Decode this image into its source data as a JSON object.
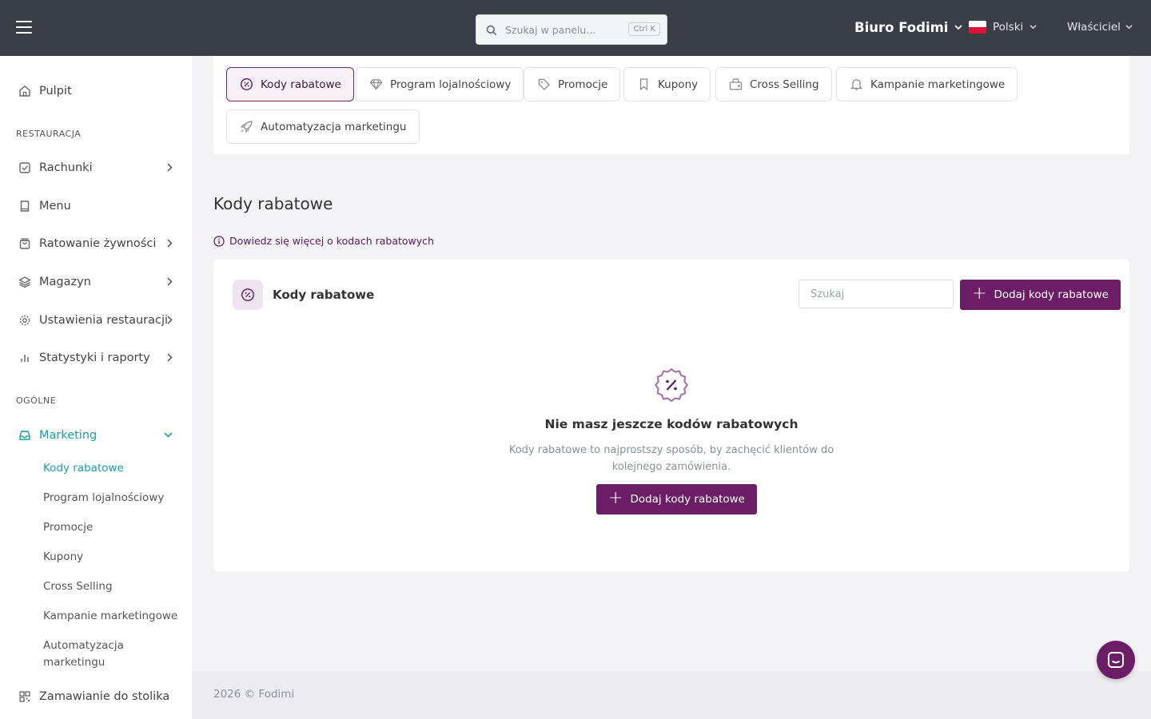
{
  "topbar": {
    "search_placeholder": "Szukaj w panelu...",
    "search_shortcut": "Ctrl K",
    "organization": "Biuro Fodimi",
    "language": "Polski",
    "role": "Właściciel"
  },
  "sidebar": {
    "dashboard": "Pulpit",
    "section_restaurant": "RESTAURACJA",
    "items": [
      {
        "label": "Rachunki",
        "icon": "receipt-check-icon"
      },
      {
        "label": "Menu",
        "icon": "book-icon"
      },
      {
        "label": "Ratowanie żywności",
        "icon": "shopping-bag-icon"
      },
      {
        "label": "Magazyn",
        "icon": "layers-icon"
      },
      {
        "label": "Ustawienia restauracji",
        "icon": "gear-icon"
      },
      {
        "label": "Statystyki i raporty",
        "icon": "bar-chart-icon"
      }
    ],
    "section_general": "OGÓLNE",
    "marketing": "Marketing",
    "marketing_sub": [
      "Kody rabatowe",
      "Program lojalnościowy",
      "Promocje",
      "Kupony",
      "Cross Selling",
      "Kampanie marketingowe",
      "Automatyzacja marketingu"
    ],
    "table_ordering": "Zamawianie do stolika"
  },
  "tabs": [
    {
      "label": "Kody rabatowe",
      "icon": "discount-badge-icon"
    },
    {
      "label": "Program lojalnościowy",
      "icon": "diamond-icon"
    },
    {
      "label": "Promocje",
      "icon": "tag-icon"
    },
    {
      "label": "Kupony",
      "icon": "bookmark-icon"
    },
    {
      "label": "Cross Selling",
      "icon": "basket-icon"
    },
    {
      "label": "Kampanie marketingowe",
      "icon": "bell-icon"
    },
    {
      "label": "Automatyzacja marketingu",
      "icon": "rocket-icon"
    }
  ],
  "page": {
    "title": "Kody rabatowe",
    "learn_more": "Dowiedz się więcej o kodach rabatowych"
  },
  "card": {
    "title": "Kody rabatowe",
    "search_placeholder": "Szukaj",
    "add_button": "Dodaj kody rabatowe",
    "empty_title": "Nie masz jeszcze kodów rabatowych",
    "empty_desc": "Kody rabatowe to najprostszy sposób, by zachęcić klientów do kolejnego zamówienia.",
    "empty_button": "Dodaj kody rabatowe"
  },
  "footer": {
    "text": "2026 © Fodimi"
  },
  "colors": {
    "topbar": "#3a3f47",
    "primary": "#6b1e66",
    "active_nav": "#1a9bb0"
  }
}
